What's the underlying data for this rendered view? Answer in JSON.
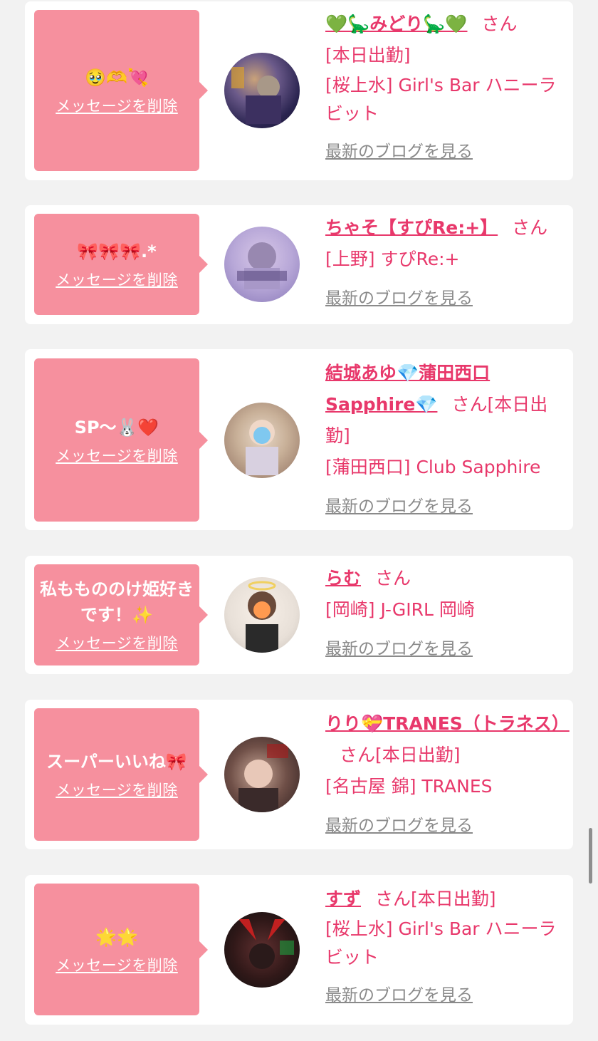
{
  "items": [
    {
      "message": "🥹🫶💘",
      "delete_label": "メッセージを削除",
      "name": "💚🦕みどり🦕💚",
      "honorific": "さん",
      "status": "[本日出勤]",
      "shop": "[桜上水] Girl's Bar ハニーラビット",
      "blog_label": "最新のブログを見る"
    },
    {
      "message": "🎀🎀🎀.*",
      "delete_label": "メッセージを削除",
      "name": "ちゃそ【すぴRe:+】",
      "honorific": "さん",
      "status": "",
      "shop": "[上野] すぴRe:+",
      "blog_label": "最新のブログを見る"
    },
    {
      "message": "SP〜🐰❤️",
      "delete_label": "メッセージを削除",
      "name": "結城あゆ💎蒲田西口Sapphire💎",
      "honorific": "さん",
      "status": "[本日出勤]",
      "shop": "[蒲田西口] Club Sapphire",
      "blog_label": "最新のブログを見る"
    },
    {
      "message": "私ももののけ姫好きです！✨",
      "delete_label": "メッセージを削除",
      "name": "らむ",
      "honorific": "さん",
      "status": "",
      "shop": "[岡崎] J-GIRL 岡崎",
      "blog_label": "最新のブログを見る"
    },
    {
      "message": "スーパーいいね🎀",
      "delete_label": "メッセージを削除",
      "name": "りり💝TRANES（トラネス）",
      "honorific": "さん",
      "status": "[本日出勤]",
      "shop": "[名古屋 錦] TRANES",
      "blog_label": "最新のブログを見る"
    },
    {
      "message": "🌟🌟",
      "delete_label": "メッセージを削除",
      "name": "すず",
      "honorific": "さん",
      "status": "[本日出勤]",
      "shop": "[桜上水] Girl's Bar ハニーラビット",
      "blog_label": "最新のブログを見る"
    }
  ],
  "colors": {
    "accent": "#e8386b",
    "bubble": "#f6909e",
    "background": "#f2f2f2",
    "link_gray": "#8a8a8a"
  }
}
